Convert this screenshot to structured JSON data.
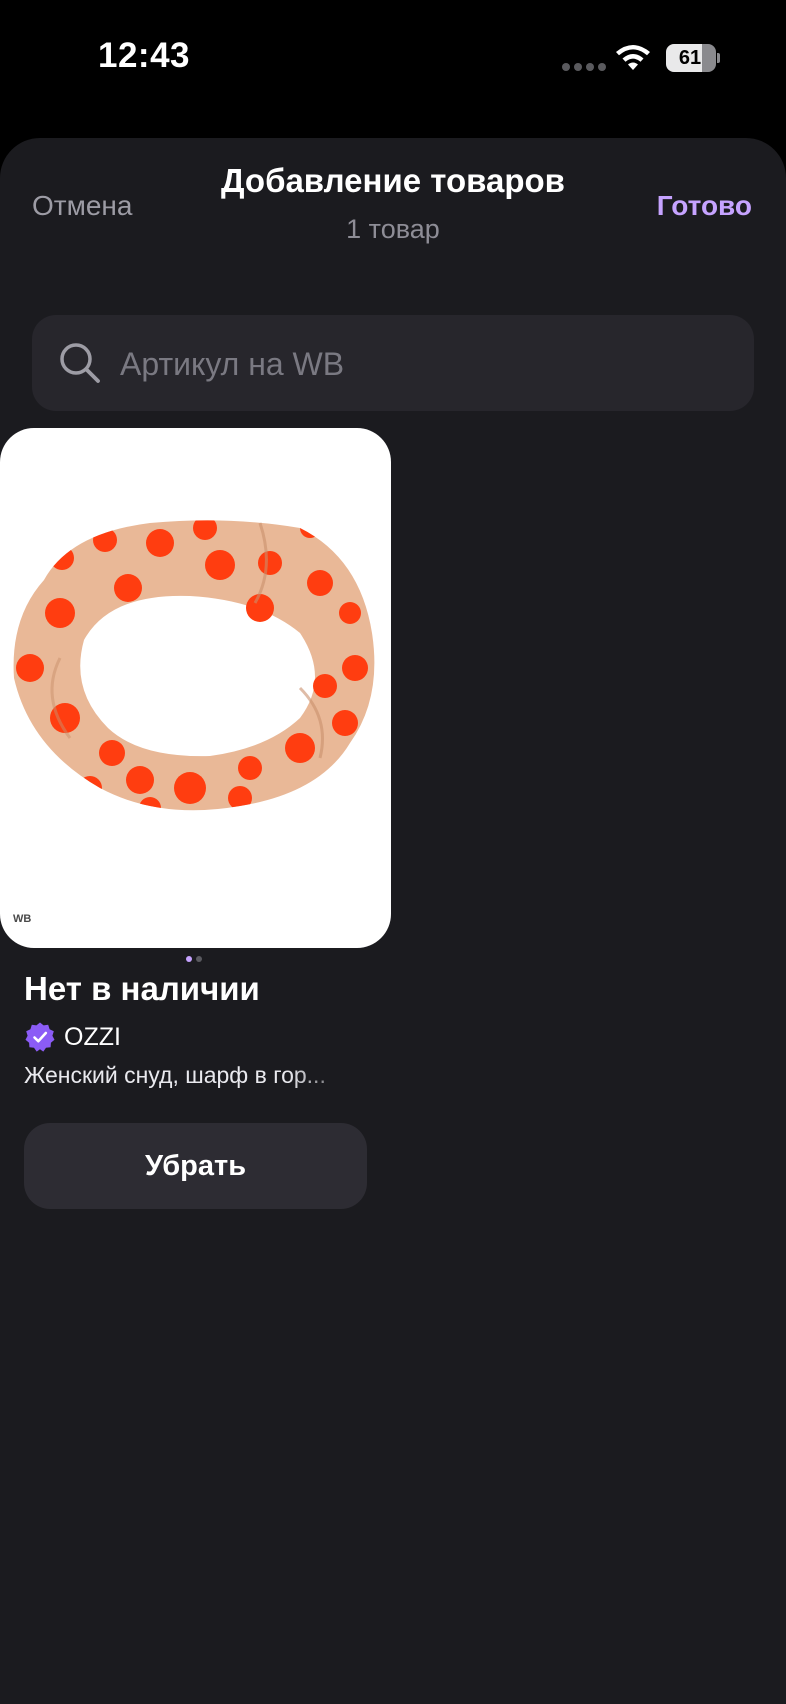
{
  "status_bar": {
    "time": "12:43",
    "battery": "61"
  },
  "header": {
    "cancel_label": "Отмена",
    "title": "Добавление товаров",
    "subtitle": "1 товар",
    "done_label": "Готово"
  },
  "search": {
    "placeholder": "Артикул на WB",
    "value": ""
  },
  "product": {
    "image_alt": "Женский снуд, шарф в горох",
    "watermark": "WB",
    "image_count": 2,
    "active_image": 1,
    "stock_status": "Нет в наличии",
    "brand": "OZZI",
    "brand_verified": true,
    "description": "Женский снуд, шарф в гор...",
    "remove_label": "Убрать"
  },
  "colors": {
    "background": "#000000",
    "sheet": "#1b1b1f",
    "accent": "#c6a3ff",
    "verified_badge": "#8b5cf6",
    "button": "#2d2c33",
    "scarf_base": "#e9b897",
    "scarf_dots": "#ff3d10"
  }
}
